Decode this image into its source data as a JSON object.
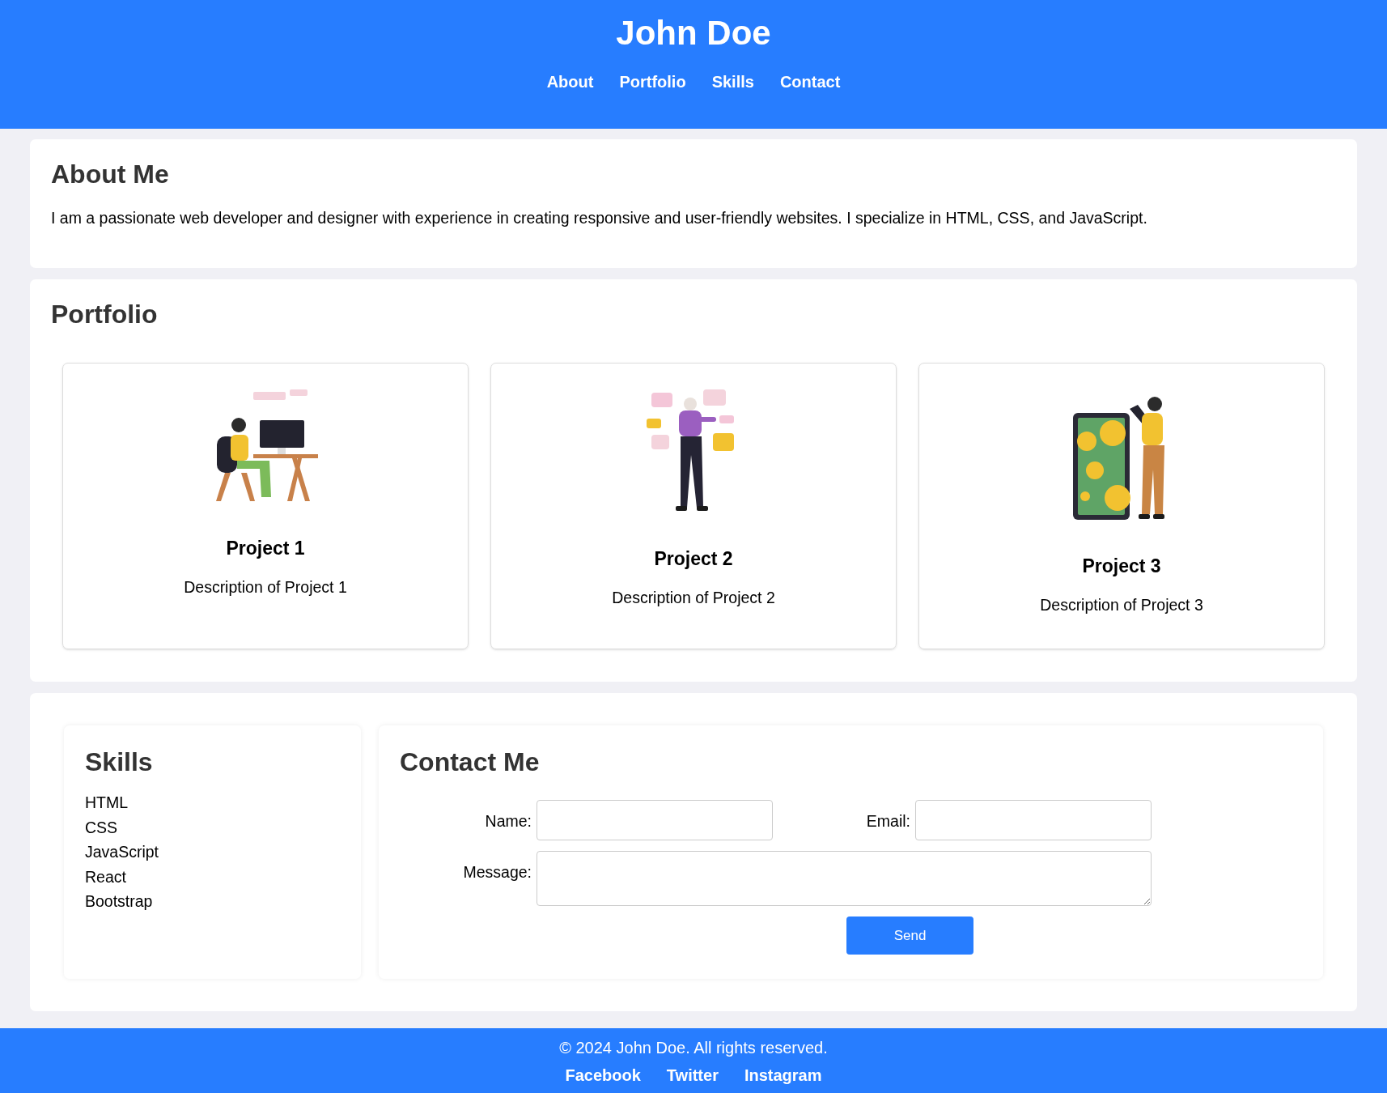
{
  "header": {
    "title": "John Doe",
    "nav": [
      "About",
      "Portfolio",
      "Skills",
      "Contact"
    ]
  },
  "about": {
    "heading": "About Me",
    "text": "I am a passionate web developer and designer with experience in creating responsive and user-friendly websites. I specialize in HTML, CSS, and JavaScript."
  },
  "portfolio": {
    "heading": "Portfolio",
    "projects": [
      {
        "title": "Project 1",
        "description": "Description of Project 1"
      },
      {
        "title": "Project 2",
        "description": "Description of Project 2"
      },
      {
        "title": "Project 3",
        "description": "Description of Project 3"
      }
    ]
  },
  "skills": {
    "heading": "Skills",
    "items": [
      "HTML",
      "CSS",
      "JavaScript",
      "React",
      "Bootstrap"
    ]
  },
  "contact": {
    "heading": "Contact Me",
    "name_label": "Name:",
    "email_label": "Email:",
    "message_label": "Message:",
    "button": "Send"
  },
  "footer": {
    "copyright": "© 2024 John Doe. All rights reserved.",
    "links": [
      "Facebook",
      "Twitter",
      "Instagram"
    ]
  }
}
